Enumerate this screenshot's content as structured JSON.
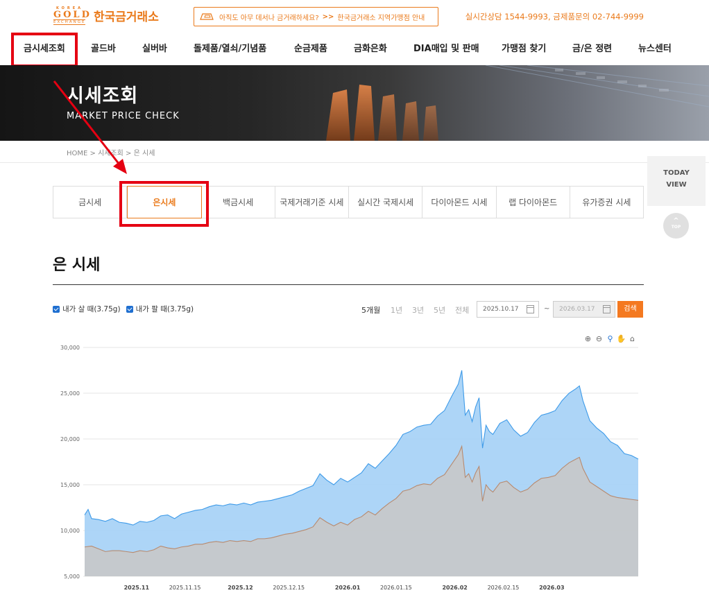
{
  "header": {
    "logo_korea": "KOREA",
    "logo_gold": "GOLD",
    "logo_exchange": "EXCHANGE",
    "logo_name": "한국금거래소",
    "notice_text": "아직도 아무 데서나 금거래하세요?",
    "notice_arrows": ">>",
    "notice_link": "한국금거래소 지역가맹점 안내",
    "contact": "실시간상담 1544-9993, 금제품문의 02-744-9999"
  },
  "nav": {
    "items": [
      {
        "label": "금시세조회"
      },
      {
        "label": "골드바"
      },
      {
        "label": "실버바"
      },
      {
        "label": "돌제품/열쇠/기념품"
      },
      {
        "label": "순금제품"
      },
      {
        "label": "금화은화"
      },
      {
        "label": "DIA매입 및 판매"
      },
      {
        "label": "가맹점 찾기"
      },
      {
        "label": "금/은 정련"
      },
      {
        "label": "뉴스센터"
      }
    ]
  },
  "banner": {
    "title": "시세조회",
    "subtitle": "MARKET PRICE CHECK"
  },
  "breadcrumb": "HOME > 시세조회 > 은 시세",
  "today_view": {
    "line1": "TODAY",
    "line2": "VIEW"
  },
  "top_button": "TOP",
  "tabs": [
    {
      "label": "금시세",
      "active": false
    },
    {
      "label": "은시세",
      "active": true
    },
    {
      "label": "백금시세",
      "active": false
    },
    {
      "label": "국제거래기준 시세",
      "active": false
    },
    {
      "label": "실시간 국제시세",
      "active": false
    },
    {
      "label": "다이아몬드 시세",
      "active": false
    },
    {
      "label": "랩 다이아몬드",
      "active": false
    },
    {
      "label": "유가증권 시세",
      "active": false
    }
  ],
  "section_title": "은 시세",
  "controls": {
    "check_buy": "내가 살 때(3.75g)",
    "check_sell": "내가 팔 때(3.75g)",
    "ranges": [
      "5개월",
      "1년",
      "3년",
      "5년",
      "전체"
    ],
    "active_range": "5개월",
    "date_from": "2025.10.17",
    "date_tilde": "~",
    "date_to": "2026.03.17",
    "search": "검색"
  },
  "colors": {
    "brand": "#ea7a1b",
    "highlight": "#e50012",
    "buy_fill": "#a9d3f7",
    "buy_line": "#3d9ae8",
    "sell_fill": "#c8c8c8",
    "sell_line": "#b88a6e"
  },
  "chart_data": {
    "type": "area",
    "ylim": [
      5000,
      30000
    ],
    "yticks": [
      5000,
      10000,
      15000,
      20000,
      25000,
      30000
    ],
    "ytick_labels": [
      "5,000",
      "10,000",
      "15,000",
      "20,000",
      "25,000",
      "30,000"
    ],
    "xlim": [
      0,
      151
    ],
    "xticks": [
      {
        "x": 15,
        "label": "2025.11",
        "bold": true
      },
      {
        "x": 29,
        "label": "2025.11.15",
        "bold": false
      },
      {
        "x": 45,
        "label": "2025.12",
        "bold": true
      },
      {
        "x": 59,
        "label": "2025.12.15",
        "bold": false
      },
      {
        "x": 76,
        "label": "2026.01",
        "bold": true
      },
      {
        "x": 90,
        "label": "2026.01.15",
        "bold": false
      },
      {
        "x": 107,
        "label": "2026.02",
        "bold": true
      },
      {
        "x": 121,
        "label": "2026.02.15",
        "bold": false
      },
      {
        "x": 135,
        "label": "2026.03",
        "bold": true
      }
    ],
    "series": [
      {
        "role": "buy",
        "points": [
          [
            0,
            11700
          ],
          [
            1,
            12300
          ],
          [
            2,
            11300
          ],
          [
            4,
            11200
          ],
          [
            6,
            11000
          ],
          [
            8,
            11300
          ],
          [
            10,
            10900
          ],
          [
            12,
            10800
          ],
          [
            14,
            10600
          ],
          [
            16,
            11000
          ],
          [
            18,
            10900
          ],
          [
            20,
            11100
          ],
          [
            22,
            11600
          ],
          [
            24,
            11700
          ],
          [
            26,
            11300
          ],
          [
            28,
            11800
          ],
          [
            30,
            12000
          ],
          [
            32,
            12200
          ],
          [
            34,
            12300
          ],
          [
            36,
            12600
          ],
          [
            38,
            12800
          ],
          [
            40,
            12700
          ],
          [
            42,
            12900
          ],
          [
            44,
            12800
          ],
          [
            46,
            13000
          ],
          [
            48,
            12800
          ],
          [
            50,
            13100
          ],
          [
            52,
            13200
          ],
          [
            54,
            13300
          ],
          [
            56,
            13500
          ],
          [
            58,
            13700
          ],
          [
            60,
            13900
          ],
          [
            62,
            14300
          ],
          [
            64,
            14600
          ],
          [
            66,
            14900
          ],
          [
            68,
            16200
          ],
          [
            70,
            15500
          ],
          [
            72,
            15000
          ],
          [
            74,
            15700
          ],
          [
            76,
            15300
          ],
          [
            78,
            15800
          ],
          [
            80,
            16300
          ],
          [
            82,
            17300
          ],
          [
            84,
            16800
          ],
          [
            86,
            17600
          ],
          [
            88,
            18400
          ],
          [
            90,
            19300
          ],
          [
            92,
            20500
          ],
          [
            94,
            20800
          ],
          [
            96,
            21300
          ],
          [
            98,
            21500
          ],
          [
            100,
            21600
          ],
          [
            102,
            22500
          ],
          [
            104,
            23100
          ],
          [
            106,
            24600
          ],
          [
            108,
            26000
          ],
          [
            109,
            27500
          ],
          [
            110,
            22600
          ],
          [
            111,
            23200
          ],
          [
            112,
            21900
          ],
          [
            113,
            23500
          ],
          [
            114,
            24500
          ],
          [
            115,
            19000
          ],
          [
            116,
            21500
          ],
          [
            117,
            20800
          ],
          [
            118,
            20500
          ],
          [
            120,
            21700
          ],
          [
            122,
            22100
          ],
          [
            124,
            21000
          ],
          [
            126,
            20300
          ],
          [
            128,
            20700
          ],
          [
            130,
            21800
          ],
          [
            132,
            22600
          ],
          [
            134,
            22800
          ],
          [
            136,
            23100
          ],
          [
            138,
            24200
          ],
          [
            140,
            25000
          ],
          [
            142,
            25500
          ],
          [
            143,
            25800
          ],
          [
            144,
            24200
          ],
          [
            146,
            22000
          ],
          [
            148,
            21200
          ],
          [
            150,
            20600
          ],
          [
            152,
            19700
          ],
          [
            154,
            19300
          ],
          [
            156,
            18400
          ],
          [
            158,
            18200
          ],
          [
            160,
            17800
          ]
        ]
      },
      {
        "role": "sell",
        "points": [
          [
            0,
            8200
          ],
          [
            2,
            8300
          ],
          [
            4,
            8000
          ],
          [
            6,
            7700
          ],
          [
            8,
            7800
          ],
          [
            10,
            7800
          ],
          [
            12,
            7700
          ],
          [
            14,
            7600
          ],
          [
            16,
            7800
          ],
          [
            18,
            7700
          ],
          [
            20,
            7900
          ],
          [
            22,
            8300
          ],
          [
            24,
            8100
          ],
          [
            26,
            8000
          ],
          [
            28,
            8200
          ],
          [
            30,
            8300
          ],
          [
            32,
            8500
          ],
          [
            34,
            8500
          ],
          [
            36,
            8700
          ],
          [
            38,
            8800
          ],
          [
            40,
            8700
          ],
          [
            42,
            8900
          ],
          [
            44,
            8800
          ],
          [
            46,
            8900
          ],
          [
            48,
            8800
          ],
          [
            50,
            9100
          ],
          [
            52,
            9100
          ],
          [
            54,
            9200
          ],
          [
            56,
            9400
          ],
          [
            58,
            9600
          ],
          [
            60,
            9700
          ],
          [
            62,
            9900
          ],
          [
            64,
            10100
          ],
          [
            66,
            10400
          ],
          [
            68,
            11400
          ],
          [
            70,
            10900
          ],
          [
            72,
            10500
          ],
          [
            74,
            10900
          ],
          [
            76,
            10600
          ],
          [
            78,
            11200
          ],
          [
            80,
            11500
          ],
          [
            82,
            12100
          ],
          [
            84,
            11700
          ],
          [
            86,
            12400
          ],
          [
            88,
            13000
          ],
          [
            90,
            13500
          ],
          [
            92,
            14300
          ],
          [
            94,
            14500
          ],
          [
            96,
            14900
          ],
          [
            98,
            15100
          ],
          [
            100,
            15000
          ],
          [
            102,
            15700
          ],
          [
            104,
            16100
          ],
          [
            106,
            17200
          ],
          [
            108,
            18300
          ],
          [
            109,
            19200
          ],
          [
            110,
            15800
          ],
          [
            111,
            16200
          ],
          [
            112,
            15300
          ],
          [
            113,
            16300
          ],
          [
            114,
            17000
          ],
          [
            115,
            13200
          ],
          [
            116,
            15000
          ],
          [
            117,
            14500
          ],
          [
            118,
            14200
          ],
          [
            120,
            15200
          ],
          [
            122,
            15400
          ],
          [
            124,
            14700
          ],
          [
            126,
            14200
          ],
          [
            128,
            14500
          ],
          [
            130,
            15200
          ],
          [
            132,
            15700
          ],
          [
            134,
            15800
          ],
          [
            136,
            16000
          ],
          [
            138,
            16800
          ],
          [
            140,
            17400
          ],
          [
            142,
            17800
          ],
          [
            143,
            18000
          ],
          [
            144,
            16800
          ],
          [
            146,
            15300
          ],
          [
            148,
            14800
          ],
          [
            150,
            14300
          ],
          [
            152,
            13800
          ],
          [
            154,
            13600
          ],
          [
            156,
            13500
          ],
          [
            158,
            13400
          ],
          [
            160,
            13300
          ]
        ]
      }
    ]
  }
}
